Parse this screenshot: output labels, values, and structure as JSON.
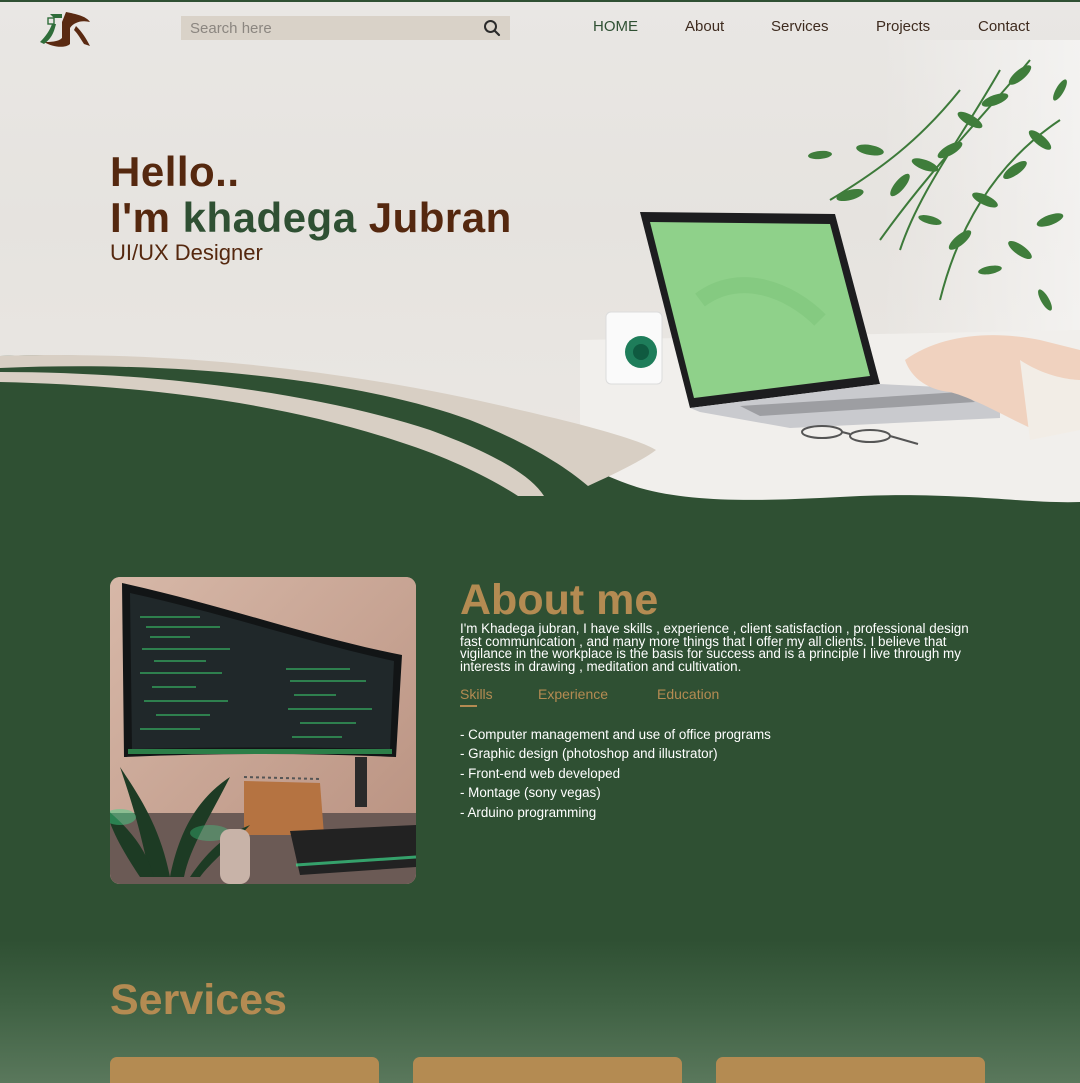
{
  "nav": {
    "search_placeholder": "Search here",
    "links": [
      "HOME",
      "About",
      "Services",
      "Projects",
      "Contact"
    ]
  },
  "hero": {
    "greeting": "Hello..",
    "intro_prefix": "I'm ",
    "first_name": "khadega",
    "last_name": " Jubran",
    "role": "UI/UX Designer"
  },
  "about": {
    "title": "About me",
    "description": "I'm Khadega jubran, I have skills , experience , client satisfaction , professional design fast communication , and many more things that I offer my all clients. I believe that vigilance in the workplace is the basis for success and is a principle I live through my interests in drawing , meditation and cultivation.",
    "tabs": [
      "Skills",
      "Experience",
      "Education"
    ],
    "active_tab": "Skills",
    "skills": [
      "- Computer management and use of office programs",
      "- Graphic design (photoshop and illustrator)",
      "- Front-end web developed",
      "- Montage (sony vegas)",
      "- Arduino programming"
    ]
  },
  "services": {
    "title": "Services",
    "card_count_visible": 3
  },
  "colors": {
    "dark_green": "#2f5033",
    "brown": "#55280f",
    "gold": "#b48b52",
    "beige": "#d9d2c8"
  }
}
